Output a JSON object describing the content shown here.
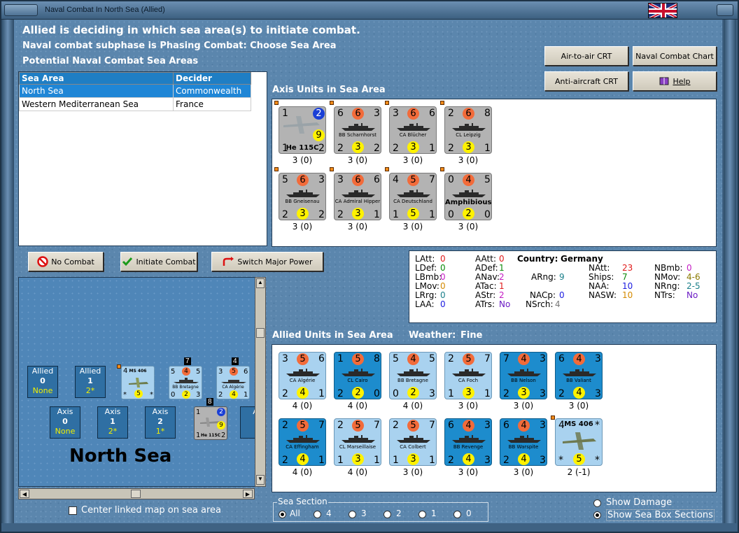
{
  "window": {
    "title": "Naval Combat In North Sea (Allied)"
  },
  "header": {
    "line1": "Allied is deciding in which sea area(s) to initiate combat.",
    "line2": "Naval combat subphase is Phasing Combat: Choose Sea Area",
    "line3": "Potential Naval Combat Sea Areas"
  },
  "buttons": {
    "air_to_air": "Air-to-air CRT",
    "naval_chart": "Naval Combat Chart",
    "anti_aircraft": "Anti-aircraft CRT",
    "help": "Help",
    "no_combat": "No Combat",
    "initiate": "Initiate Combat",
    "switch": "Switch Major Power"
  },
  "sea_table": {
    "headers": [
      "Sea Area",
      "Decider"
    ],
    "rows": [
      {
        "area": "North Sea",
        "decider": "Commonwealth",
        "selected": true
      },
      {
        "area": "Western Mediterranean Sea",
        "decider": "France",
        "selected": false
      }
    ]
  },
  "axis_section": {
    "title": "Axis Units in Sea Area"
  },
  "axis_units": [
    {
      "name": "He 115C",
      "tl": "1",
      "tc": "",
      "tr": "2",
      "bl": "1",
      "bc": "9",
      "br": "2",
      "cap": "3 (0)",
      "kind": "air"
    },
    {
      "name": "BB Scharnhorst",
      "tl": "6",
      "tc": "6",
      "tr": "3",
      "bl": "2",
      "bc": "3",
      "br": "2",
      "cap": "3 (0)",
      "kind": "ship"
    },
    {
      "name": "CA Blücher",
      "tl": "3",
      "tc": "6",
      "tr": "6",
      "bl": "2",
      "bc": "3",
      "br": "1",
      "cap": "3 (0)",
      "kind": "ship"
    },
    {
      "name": "CL Leipzig",
      "tl": "2",
      "tc": "6",
      "tr": "8",
      "bl": "2",
      "bc": "3",
      "br": "1",
      "cap": "3 (0)",
      "kind": "ship"
    },
    {
      "name": "BB Gneisenau",
      "tl": "5",
      "tc": "6",
      "tr": "3",
      "bl": "2",
      "bc": "3",
      "br": "2",
      "cap": "3 (0)",
      "kind": "ship"
    },
    {
      "name": "CA Admiral Hipper",
      "tl": "3",
      "tc": "6",
      "tr": "6",
      "bl": "2",
      "bc": "3",
      "br": "1",
      "cap": "3 (0)",
      "kind": "ship"
    },
    {
      "name": "CA Deutschland",
      "tl": "4",
      "tc": "5",
      "tr": "7",
      "bl": "1",
      "bc": "5",
      "br": "1",
      "cap": "3 (0)",
      "kind": "ship"
    },
    {
      "name": "Amphibious",
      "tl": "0",
      "tc": "4",
      "tr": "5",
      "bl": "0",
      "bc": "2",
      "br": "0",
      "cap": "3 (0)",
      "kind": "amph"
    }
  ],
  "stats": {
    "country_label": "Country:",
    "country": "Germany",
    "items": [
      {
        "k": "LAtt:",
        "v": "0",
        "c": "red"
      },
      {
        "k": "LDef:",
        "v": "0",
        "c": "green"
      },
      {
        "k": "LBmb:",
        "v": "0",
        "c": "mag"
      },
      {
        "k": "LMov:",
        "v": "0",
        "c": "org"
      },
      {
        "k": "LRrg:",
        "v": "0",
        "c": "teal"
      },
      {
        "k": "LAA:",
        "v": "0",
        "c": "blue"
      },
      {
        "k": "AAtt:",
        "v": "0",
        "c": "red"
      },
      {
        "k": "ADef:",
        "v": "1",
        "c": "green"
      },
      {
        "k": "ANav:",
        "v": "2",
        "c": "mag"
      },
      {
        "k": "ATac:",
        "v": "1",
        "c": "red"
      },
      {
        "k": "AStr:",
        "v": "2",
        "c": "mag"
      },
      {
        "k": "ATrs:",
        "v": "No",
        "c": "purple"
      },
      {
        "k": "ARng:",
        "v": "9",
        "c": "teal"
      },
      {
        "k": "NACp:",
        "v": "0",
        "c": "blue"
      },
      {
        "k": "NSrch:",
        "v": "4",
        "c": "gray"
      },
      {
        "k": "NAtt:",
        "v": "23",
        "c": "red"
      },
      {
        "k": "Ships:",
        "v": "7",
        "c": "green"
      },
      {
        "k": "NAA:",
        "v": "10",
        "c": "blue"
      },
      {
        "k": "NASW:",
        "v": "10",
        "c": "org"
      },
      {
        "k": "NBmb:",
        "v": "0",
        "c": "mag"
      },
      {
        "k": "NMov:",
        "v": "4-6",
        "c": "olive"
      },
      {
        "k": "NRng:",
        "v": "2-5",
        "c": "teal"
      },
      {
        "k": "NTrs:",
        "v": "No",
        "c": "purple"
      }
    ]
  },
  "allied_section": {
    "title": "Allied Units in Sea Area",
    "weather_label": "Weather:",
    "weather": "Fine"
  },
  "allied_units": [
    {
      "name": "CA Algérie",
      "tl": "3",
      "tc": "5",
      "tr": "6",
      "bl": "2",
      "bc": "4",
      "br": "1",
      "cap": "4 (0)",
      "color": "lblue"
    },
    {
      "name": "CL Cairo",
      "tl": "1",
      "tc": "5",
      "tr": "8",
      "bl": "2",
      "bc": "2",
      "br": "0",
      "cap": "4 (0)",
      "color": "dblue"
    },
    {
      "name": "BB Bretagne",
      "tl": "5",
      "tc": "4",
      "tr": "5",
      "bl": "0",
      "bc": "2",
      "br": "3",
      "cap": "4 (0)",
      "color": "lblue"
    },
    {
      "name": "CA Foch",
      "tl": "2",
      "tc": "5",
      "tr": "7",
      "bl": "1",
      "bc": "3",
      "br": "1",
      "cap": "3 (0)",
      "color": "lblue"
    },
    {
      "name": "BB Nelson",
      "tl": "7",
      "tc": "4",
      "tr": "3",
      "bl": "2",
      "bc": "3",
      "br": "3",
      "cap": "3 (0)",
      "color": "dblue"
    },
    {
      "name": "BB Valiant",
      "tl": "6",
      "tc": "4",
      "tr": "3",
      "bl": "2",
      "bc": "4",
      "br": "3",
      "cap": "3 (0)",
      "color": "dblue"
    },
    {
      "name": "CA Effingham",
      "tl": "2",
      "tc": "5",
      "tr": "7",
      "bl": "2",
      "bc": "4",
      "br": "1",
      "cap": "4 (0)",
      "color": "dblue"
    },
    {
      "name": "CL Marseillaise",
      "tl": "2",
      "tc": "5",
      "tr": "7",
      "bl": "1",
      "bc": "3",
      "br": "1",
      "cap": "4 (0)",
      "color": "lblue"
    },
    {
      "name": "CA Colbert",
      "tl": "2",
      "tc": "5",
      "tr": "7",
      "bl": "1",
      "bc": "3",
      "br": "1",
      "cap": "3 (0)",
      "color": "lblue"
    },
    {
      "name": "BB Revenge",
      "tl": "6",
      "tc": "4",
      "tr": "3",
      "bl": "2",
      "bc": "4",
      "br": "3",
      "cap": "3 (0)",
      "color": "dblue"
    },
    {
      "name": "BB Warspite",
      "tl": "6",
      "tc": "4",
      "tr": "3",
      "bl": "2",
      "bc": "4",
      "br": "3",
      "cap": "3 (0)",
      "color": "dblue"
    },
    {
      "name": "MS 406",
      "tl": "4",
      "tc": "",
      "tr": "*",
      "bl": "*",
      "bc": "5",
      "br": "*",
      "cap": "2 (-1)",
      "color": "lblue",
      "air": true
    }
  ],
  "map": {
    "sea_name": "North Sea",
    "allied_boxes": [
      {
        "label": "Allied",
        "num": "0",
        "sub": "None"
      },
      {
        "label": "Allied",
        "num": "1",
        "sub": "2*"
      }
    ],
    "axis_boxes": [
      {
        "label": "Axis",
        "num": "0",
        "sub": "None"
      },
      {
        "label": "Axis",
        "num": "1",
        "sub": "2*"
      },
      {
        "label": "Axis",
        "num": "2",
        "sub": "1*"
      },
      {
        "label": "A",
        "num": "",
        "sub": ""
      }
    ],
    "stack_counts": [
      "7",
      "4",
      "8"
    ],
    "mini_ms": {
      "name": "MS 406",
      "tl": "4",
      "tr": "*",
      "bl": "*",
      "bc": "5",
      "br": "*"
    },
    "mini_bb": {
      "name": "BB Bretagne",
      "tl": "5",
      "tc": "4",
      "tr": "5",
      "bl": "0",
      "bc": "2",
      "br": "3"
    },
    "mini_ca": {
      "name": "CA Algérie",
      "tl": "3",
      "tc": "5",
      "tr": "6",
      "bl": "2",
      "bc": "4",
      "br": "1"
    },
    "mini_he": {
      "name": "He 115C",
      "tl": "1",
      "tr": "2",
      "bc": "9",
      "bl": "1",
      "br": "2"
    }
  },
  "options": {
    "center_label": "Center linked map on sea area",
    "sea_section_label": "Sea Section",
    "sea_sections": [
      "All",
      "4",
      "3",
      "2",
      "1",
      "0"
    ],
    "show_damage": "Show Damage",
    "show_boxes": "Show Sea Box Sections"
  }
}
